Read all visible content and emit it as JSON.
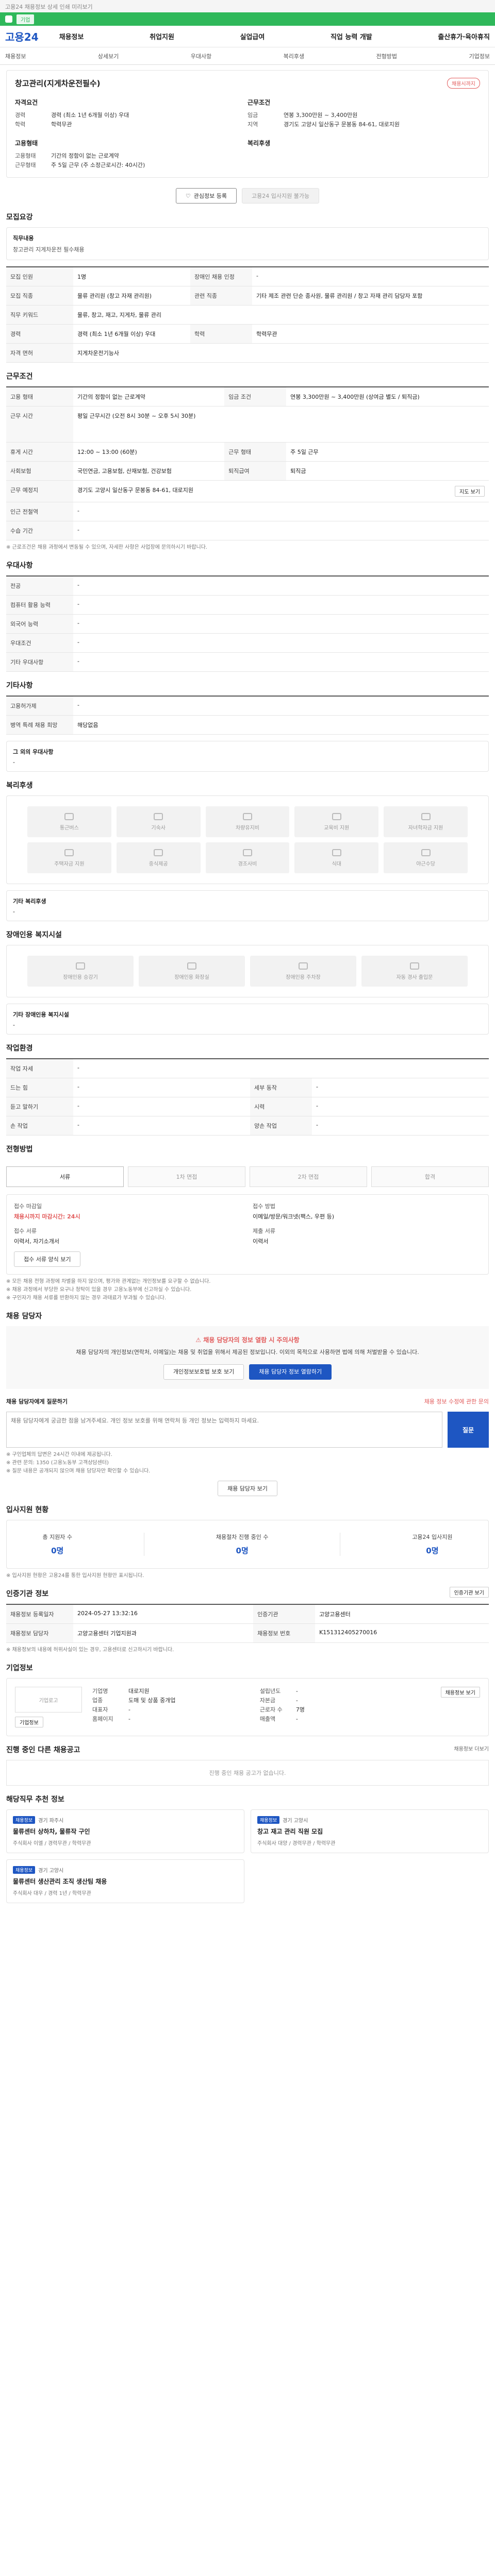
{
  "top_notice": "고용24 채용정보 상세 인쇄 미리보기",
  "green_bar": {
    "label": "기업"
  },
  "gnb": {
    "brand": "고용24",
    "menu": [
      "채용정보",
      "취업지원",
      "실업급여",
      "직업 능력 개발",
      "출산휴가·육아휴직"
    ]
  },
  "snb": [
    "채용정보",
    "상세보기",
    "우대사항",
    "복리후생",
    "전형방법",
    "기업정보"
  ],
  "job": {
    "title": "창고관리(지게차운전필수)",
    "badge": "채용시까지",
    "recruit_h": "자격요건",
    "conditions_h": "근무조건",
    "left_rows": [
      {
        "k": "경력",
        "v": "경력 (최소 1년 6개월 이상) 우대"
      },
      {
        "k": "학력",
        "v": "학력무관"
      }
    ],
    "right_rows": [
      {
        "k": "임금",
        "v": "연봉 3,300만원 ~ 3,400만원"
      },
      {
        "k": "지역",
        "v": "경기도 고양시 일산동구 문봉동 84-61, 대로지원"
      }
    ],
    "work_h": "고용형태",
    "work_rows": [
      {
        "k": "고용형태",
        "v": "기간의 정함이 없는 근로계약"
      },
      {
        "k": "근무형태",
        "v": "주 5일 근무 (주 소정근로시간: 40시간)"
      }
    ],
    "welfare_h": "복리후생",
    "btn_fav": "관심정보 등록",
    "btn_apply": "고용24 입사지원 불가능"
  },
  "recruit": {
    "title": "모집요강",
    "job_desc_h": "직무내용",
    "job_desc": "창고관리 지게차운전 필수채용",
    "rows": [
      {
        "k": "모집 인원",
        "v": "1명",
        "k2": "장애인 채용 인정",
        "v2": "-"
      },
      {
        "k": "모집 직종",
        "v": "물류 관리원 (창고 자재 관리원)",
        "k2": "관련 직종",
        "v2": "기타 제조 관련 단순 종사원, 물류 관리원 / 창고 자재 관리 담당자 포함"
      },
      {
        "k": "직무 키워드",
        "v": "물류, 창고, 재고, 지게차, 물류 관리"
      },
      {
        "k": "경력",
        "v": "경력 (최소 1년 6개월 이상) 우대",
        "k2": "학력",
        "v2": "학력무관"
      },
      {
        "k": "자격 면허",
        "v": "지게차운전기능사"
      }
    ]
  },
  "conditions": {
    "title": "근무조건",
    "rows": [
      {
        "k": "고용 형태",
        "v": "기간의 정함이 없는 근로계약",
        "k2": "임금 조건",
        "v2": "연봉 3,300만원 ~ 3,400만원 (상여금 별도 / 퇴직금)"
      },
      {
        "k": "근무 시간",
        "v": "평일 근무시간 (오전 8시 30분 ~ 오후 5시 30분)"
      },
      {
        "k": "휴게 시간",
        "v": "12:00 ~ 13:00 (60분)",
        "k2": "근무 형태",
        "v2": "주 5일 근무"
      },
      {
        "k": "사회보험",
        "v": "국민연금, 고용보험, 산재보험, 건강보험",
        "k2": "퇴직급여",
        "v2": "퇴직금"
      },
      {
        "k": "근무 예정지",
        "v": "경기도 고양시 일산동구 문봉동 84-61, 대로지원"
      },
      {
        "k": "인근 전철역",
        "v": "-"
      },
      {
        "k": "수습 기간",
        "v": "-"
      }
    ],
    "map_btn": "지도 보기",
    "note": "※ 근로조건은 채용 과정에서 변동될 수 있으며, 자세한 사항은 사업장에 문의하시기 바랍니다."
  },
  "preference": {
    "title": "우대사항",
    "rows": [
      {
        "k": "전공",
        "v": "-"
      },
      {
        "k": "컴퓨터 활용 능력",
        "v": "-"
      },
      {
        "k": "외국어 능력",
        "v": "-"
      },
      {
        "k": "우대조건",
        "v": "-"
      },
      {
        "k": "기타 우대사항",
        "v": "-"
      }
    ]
  },
  "etc": {
    "title": "기타사항",
    "rows": [
      {
        "k": "고용허가제",
        "v": "-"
      },
      {
        "k": "병역 특례 채용 희망",
        "v": "해당없음"
      }
    ],
    "extra_h": "그 외의 우대사항",
    "extra_v": "-"
  },
  "welfare": {
    "title": "복리후생",
    "tags": [
      "통근버스",
      "기숙사",
      "차량유지비",
      "교육비 지원",
      "자녀학자금 지원",
      "주택자금 지원",
      "중식제공",
      "경조사비",
      "식대",
      "야근수당"
    ],
    "other_h": "기타 복리후생",
    "other_v": "-"
  },
  "disability": {
    "title": "장애인용 복지시설",
    "tags": [
      "장애인용 승강기",
      "장애인용 화장실",
      "장애인용 주차장",
      "자동 경사 출입문"
    ],
    "other_h": "기타 장애인용 복지시설",
    "other_v": "-"
  },
  "env": {
    "title": "작업환경",
    "rows": [
      {
        "k": "작업 자세",
        "v": "-"
      },
      {
        "k": "드는 힘",
        "v": "-",
        "k2": "세부 동작",
        "v2": "-"
      },
      {
        "k": "듣고 말하기",
        "v": "-",
        "k2": "시력",
        "v2": "-"
      },
      {
        "k": "손 작업",
        "v": "-",
        "k2": "양손 작업",
        "v2": "-"
      }
    ]
  },
  "process": {
    "title": "전형방법",
    "steps": [
      "서류",
      "1차 면접",
      "2차 면접",
      "합격"
    ],
    "rows": [
      {
        "k": "접수 마감일",
        "v": "채용시까지 마감시간: 24시",
        "k2": "접수 방법",
        "v2": "이메일/방문/워크넷(팩스, 우편 등)"
      },
      {
        "k": "접수 서류",
        "v": "이력서, 자기소개서",
        "k2": "제출 서류",
        "v2": "이력서"
      }
    ],
    "btn": "접수 서류 양식 보기",
    "notes": [
      "※ 모든 채용 전형 과정에 차별을 하지 않으며, 평가와 관계없는 개인정보를 요구할 수 없습니다.",
      "※ 채용 과정에서 부당한 요구나 청탁이 있을 경우 고용노동부에 신고하실 수 있습니다.",
      "※ 구인자가 채용 서류를 반환하지 않는 경우 과태료가 부과될 수 있습니다."
    ]
  },
  "contact": {
    "title": "채용 담당자",
    "alert_title": "채용 담당자의 정보 열람 시 주의사항",
    "alert_body": "채용 담당자의 개인정보(연락처, 이메일)는 채용 및 취업을 위해서 제공된 정보입니다. 이외의 목적으로 사용하면 법에 의해 처벌받을 수 있습니다.",
    "btn1": "개인정보보호법 보호 보기",
    "btn2": "채용 담당자 정보 열람하기",
    "qa_h": "채용 담당자에게 질문하기",
    "qa_hint": "채용 정보 수정에 관한 문의",
    "qa_placeholder": "채용 담당자에게 궁금한 점을 남겨주세요. 개인 정보 보호를 위해 연락처 등 개인 정보는 입력하지 마세요.",
    "qa_btn": "질문",
    "notes": [
      "※ 구인업체의 답변은 24시간 이내에 제공됩니다.",
      "※ 관련 문의: 1350 (고용노동부 고객상담센터)",
      "※ 질문 내용은 공개되지 않으며 채용 담당자만 확인할 수 있습니다."
    ],
    "more_btn": "채용 담당자 보기"
  },
  "apply_status": {
    "title": "입사지원 현황",
    "stats": [
      {
        "label": "총 지원자 수",
        "value": "0명"
      },
      {
        "label": "채용절차 진행 중인 수",
        "value": "0명"
      },
      {
        "label": "고용24 입사지원",
        "value": "0명"
      }
    ],
    "note": "※ 입사지원 현황은 고용24를 통한 입사지원 현황만 표시됩니다."
  },
  "auth": {
    "title": "인증기관 정보",
    "btn": "인증기관 보기",
    "rows": [
      {
        "k": "채용정보 등록일자",
        "v": "2024-05-27 13:32:16",
        "k2": "인증기관",
        "v2": "고양고용센터"
      },
      {
        "k": "채용정보 담당자",
        "v": "고양고용센터 기업지원과",
        "k2": "채용정보 번호",
        "v2": "K151312405270016"
      }
    ],
    "note": "※ 채용정보의 내용에 허위사실이 있는 경우, 고용센터로 신고하시기 바랍니다."
  },
  "company": {
    "title": "기업정보",
    "logo_alt": "기업로고",
    "name_btn": "기업정보",
    "rows": [
      {
        "k": "기업명",
        "v": "대로지원",
        "k2": "설립년도",
        "v2": "-"
      },
      {
        "k": "업종",
        "v": "도매 및 상품 중개업",
        "k2": "자본금",
        "v2": "-"
      },
      {
        "k": "대표자",
        "v": "-",
        "k2": "근로자 수",
        "v2": "7명"
      },
      {
        "k": "홈페이지",
        "v": "-",
        "k2": "매출액",
        "v2": "-"
      }
    ],
    "link_btn": "채용정보 보기"
  },
  "ongoing": {
    "title": "진행 중인 다른 채용공고",
    "more": "채용정보 더보기",
    "empty": "진행 중인 채용 공고가 없습니다."
  },
  "similar": {
    "title": "해당직무 추천 정보",
    "cards": [
      {
        "chip": "채용정보",
        "region": "경기 파주시",
        "title": "물류센터 상하차, 물류작 구인",
        "sub": "주식회사 이엘 / 경력무관 / 학력무관"
      },
      {
        "chip": "채용정보",
        "region": "경기 고양시",
        "title": "창고 재고 관리 직원 모집",
        "sub": "주식회사 대양 / 경력무관 / 학력무관"
      },
      {
        "chip": "채용정보",
        "region": "경기 고양시",
        "title": "물류센터 생산관리 조직 생산팀 채용",
        "sub": "주식회사 대우 / 경력 1년 / 학력무관"
      }
    ]
  }
}
